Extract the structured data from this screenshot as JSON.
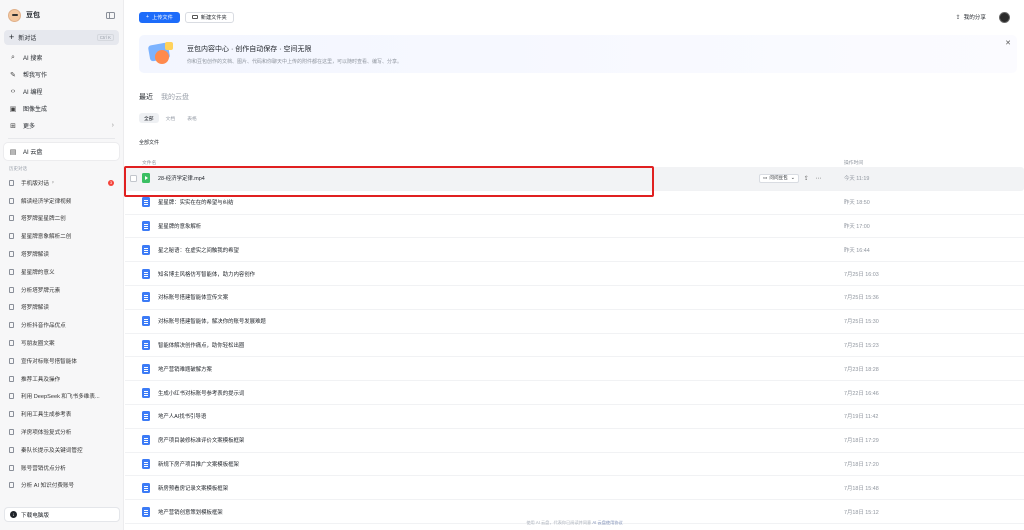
{
  "app": {
    "name": "豆包"
  },
  "sidebar": {
    "new_chat": "新对话",
    "new_chat_shortcut": "Ctrl K",
    "nav": [
      {
        "label": "AI 搜索",
        "icon": "search-icon"
      },
      {
        "label": "帮我写作",
        "icon": "pen-icon"
      },
      {
        "label": "AI 编程",
        "icon": "code-icon"
      },
      {
        "label": "图像生成",
        "icon": "image-icon"
      },
      {
        "label": "更多",
        "icon": "grid-icon"
      }
    ],
    "cloud": "AI 云盘",
    "history_title": "历史对话",
    "history": [
      "手机版对话",
      "解读经济学定律视频",
      "塔罗牌星星牌二创",
      "星星牌意象解析二创",
      "塔罗牌解读",
      "星星牌的意义",
      "分析塔罗牌元素",
      "塔罗牌解读",
      "分析抖音作品优点",
      "写朋友圈文案",
      "宣传对标账号搭智能体",
      "推荐工具及操作",
      "利用 DeepSeek 和飞书多维表...",
      "利用工具生成参考表",
      "洋房项体验复式分析",
      "秦队长提示及关键词管控",
      "账号营销优点分析",
      "分析 AI 知识付费账号"
    ],
    "history_badge": "3",
    "download": "下载电脑版"
  },
  "topbar": {
    "upload": "上传文件",
    "new_folder": "新建文件夹",
    "share": "我的分享"
  },
  "banner": {
    "title": "豆包内容中心 · 创作自动保存 · 空间无限",
    "desc": "你和豆包创作的文档、图片、代码和你聊天中上传的附件都在这里，可以随时查看、编写、分享。"
  },
  "tabs": [
    "最近",
    "我的云盘"
  ],
  "filters": [
    "全部",
    "文档",
    "表格"
  ],
  "section_label": "全部文件",
  "table": {
    "col_name": "文件名",
    "col_time": "操作时间",
    "ask_label": "问问豆包",
    "rows": [
      {
        "name": "28-经济学定律.mp4",
        "time": "今天 11:19",
        "type": "video"
      },
      {
        "name": "星星牌：实实在在的希望与纠结",
        "time": "昨天 18:50",
        "type": "doc"
      },
      {
        "name": "星星牌的意象解析",
        "time": "昨天 17:00",
        "type": "doc"
      },
      {
        "name": "星之秘语：在虚实之间触我的希望",
        "time": "昨天 16:44",
        "type": "doc"
      },
      {
        "name": "知名博主风格仿写智能体，助力内容创作",
        "time": "7月25日 16:03",
        "type": "doc"
      },
      {
        "name": "对标账号搭建智能体宣传文案",
        "time": "7月25日 15:36",
        "type": "doc"
      },
      {
        "name": "对标账号搭建智能体，解决你的账号发展难题",
        "time": "7月25日 15:30",
        "type": "doc"
      },
      {
        "name": "智能体解决创作痛点，助你轻松出圈",
        "time": "7月25日 15:23",
        "type": "doc"
      },
      {
        "name": "地产营销难题破解方案",
        "time": "7月23日 18:28",
        "type": "doc"
      },
      {
        "name": "生成小红书对标账号参考表的提示词",
        "time": "7月22日 16:46",
        "type": "doc"
      },
      {
        "name": "地产人AI找书引导语",
        "time": "7月19日 11:42",
        "type": "doc"
      },
      {
        "name": "房产项目装修标准评价文案模板框架",
        "time": "7月18日 17:29",
        "type": "doc"
      },
      {
        "name": "新规下房产项目推广文案模板框架",
        "time": "7月18日 17:20",
        "type": "doc"
      },
      {
        "name": "新房预看房记录文案模板框架",
        "time": "7月18日 15:48",
        "type": "doc"
      },
      {
        "name": "地产营销创意策划模板框架",
        "time": "7月18日 15:12",
        "type": "doc"
      }
    ]
  },
  "footer": {
    "text": "使用 AI 云盘，代表你已阅读并同意",
    "link": "AI 云盘使用协议"
  }
}
